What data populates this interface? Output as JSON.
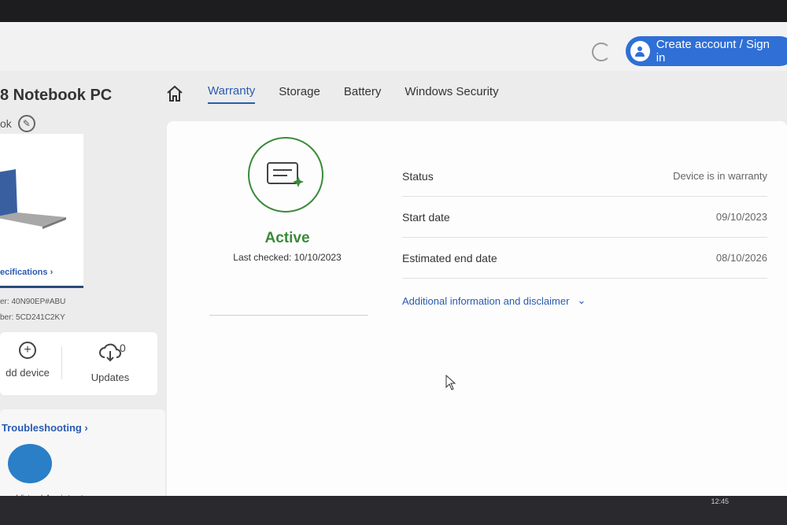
{
  "header": {
    "signin_label": "Create account / Sign in"
  },
  "device": {
    "title": "8 Notebook PC",
    "subtitle": "ok",
    "specs_link": "ecifications ›",
    "product_number": "er: 40N90EP#ABU",
    "serial_number": "ber: 5CD241C2KY"
  },
  "actions": {
    "add_device": "dd device",
    "updates": "Updates",
    "updates_count": "0"
  },
  "troubleshooting": {
    "title": "Troubleshooting ›",
    "assistant": "our Virtual Assistant"
  },
  "nav": {
    "tabs": [
      {
        "label": "Warranty",
        "active": true
      },
      {
        "label": "Storage"
      },
      {
        "label": "Battery"
      },
      {
        "label": "Windows Security"
      }
    ]
  },
  "warranty": {
    "status_word": "Active",
    "last_checked": "Last checked: 10/10/2023",
    "rows": [
      {
        "label": "Status",
        "value": "Device is in warranty"
      },
      {
        "label": "Start date",
        "value": "09/10/2023"
      },
      {
        "label": "Estimated end date",
        "value": "08/10/2026"
      }
    ],
    "more_info": "Additional information and disclaimer"
  },
  "taskbar": {
    "clock": "12:45"
  },
  "colors": {
    "accent": "#2a5bb0",
    "active_green": "#3a8a3a",
    "signin_blue": "#2f6fd6"
  }
}
